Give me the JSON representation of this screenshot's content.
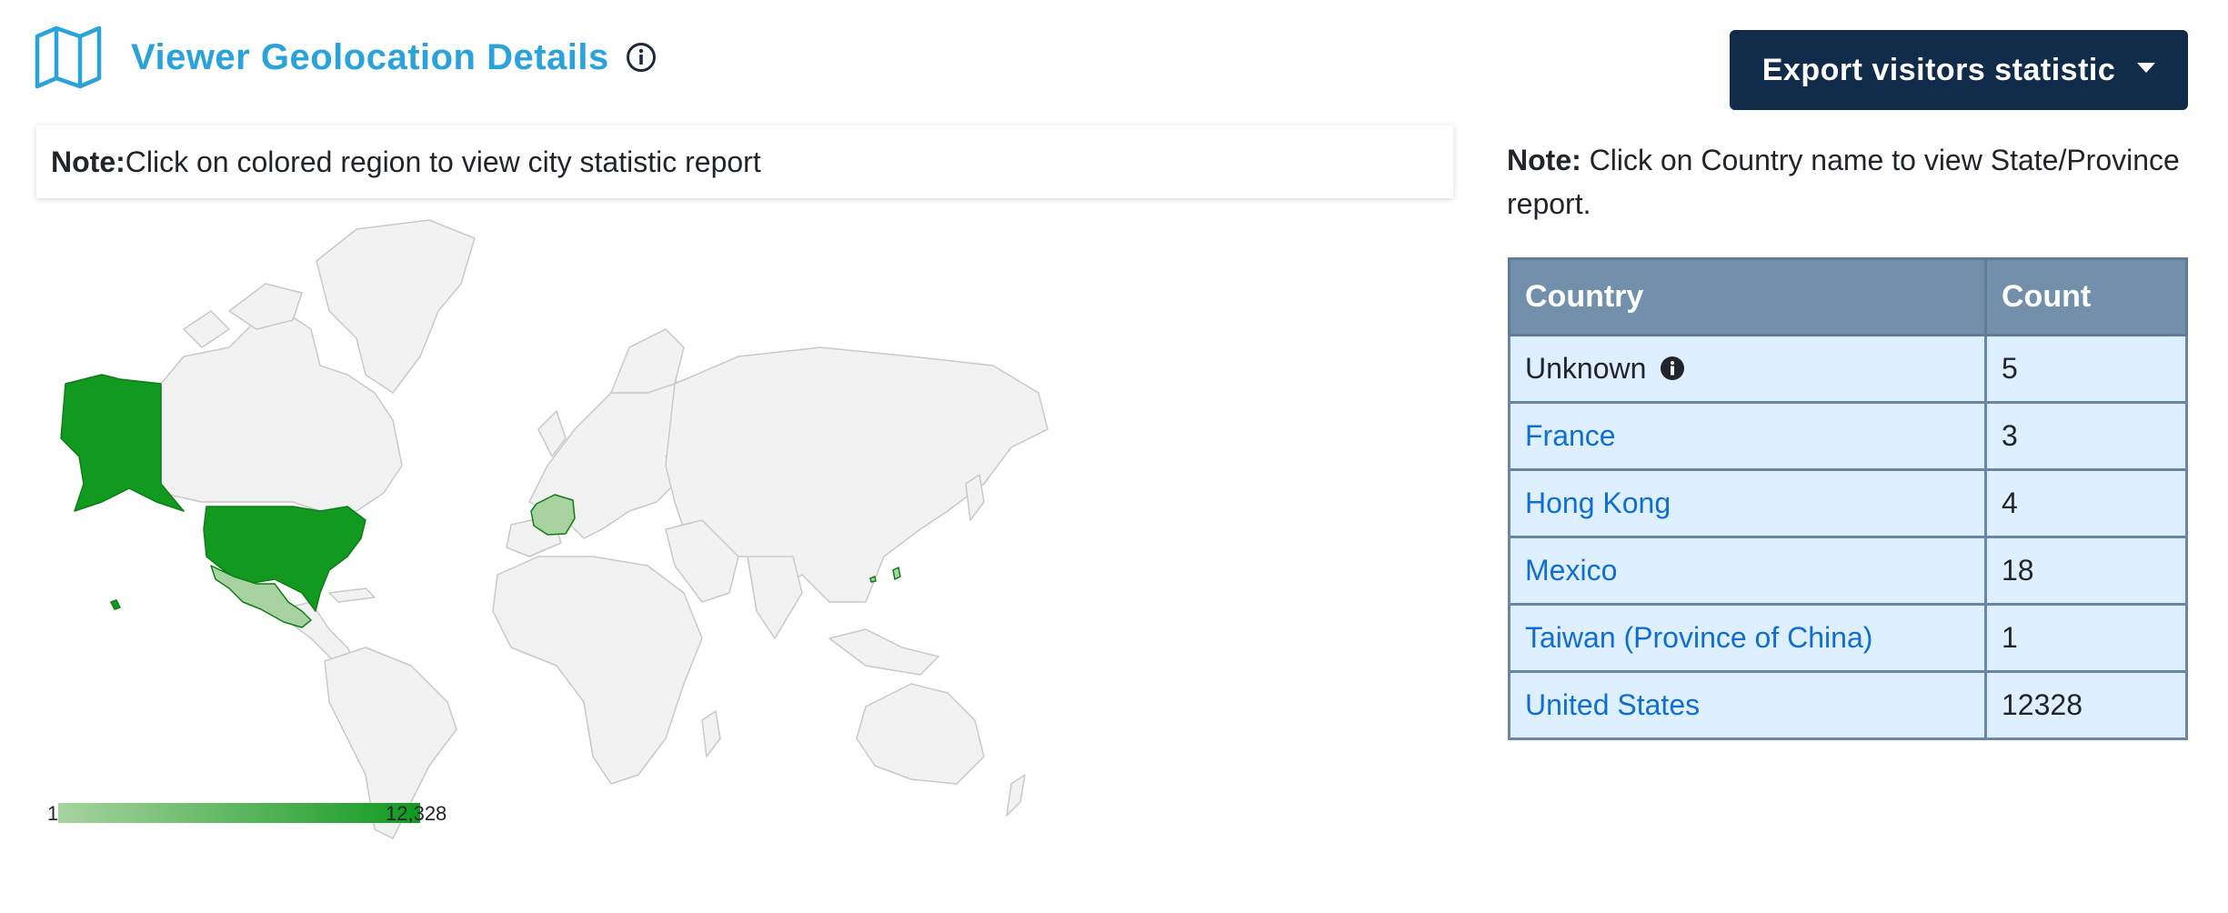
{
  "header": {
    "title": "Viewer Geolocation Details",
    "icons": {
      "map": "map-icon",
      "info": "info-circle-icon"
    }
  },
  "export": {
    "label": "Export visitors statistic"
  },
  "map_note": {
    "prefix": "Note:",
    "text": " Click on colored region to view city statistic report"
  },
  "table_note": {
    "prefix": "Note:",
    "text": " Click on Country name to view State/Province report."
  },
  "legend": {
    "min": "1",
    "max": "12,328"
  },
  "table": {
    "headers": [
      "Country",
      "Count"
    ],
    "rows": [
      {
        "country": "Unknown",
        "count": "5"
      },
      {
        "country": "France",
        "count": "3"
      },
      {
        "country": "Hong Kong",
        "count": "4"
      },
      {
        "country": "Mexico",
        "count": "18"
      },
      {
        "country": "Taiwan (Province of China)",
        "count": "1"
      },
      {
        "country": "United States",
        "count": "12328"
      }
    ]
  },
  "colors": {
    "title": "#2aa3dc",
    "button": "#112b4b",
    "table_header": "#728fab",
    "table_cell": "#deefff",
    "link": "#0f6ed4",
    "map_high": "#119a1f",
    "map_low": "#a8d3a0",
    "map_land": "#f2f2f2"
  }
}
